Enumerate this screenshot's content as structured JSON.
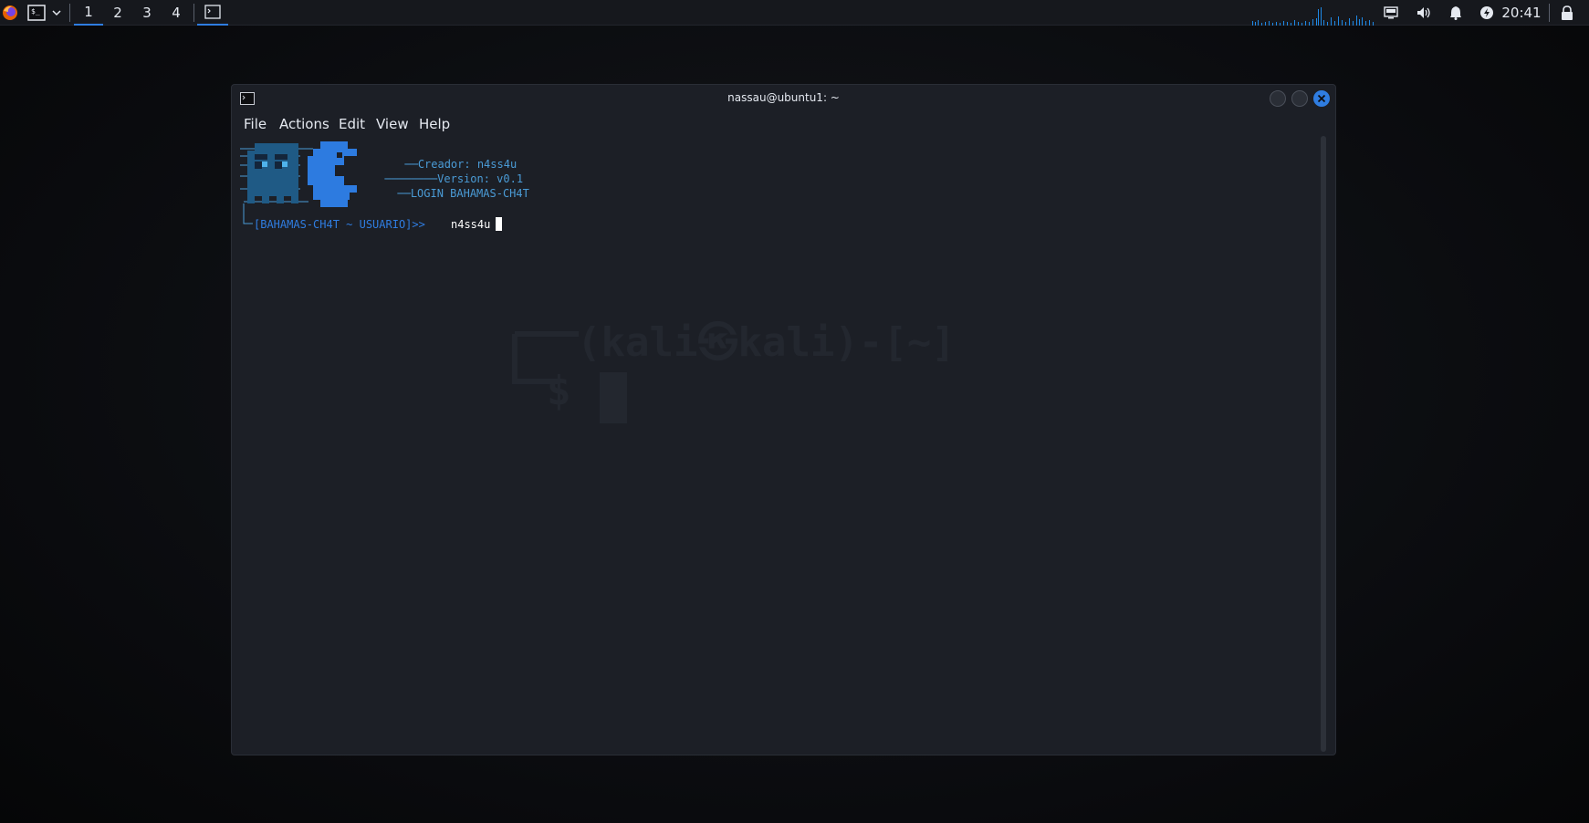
{
  "taskbar": {
    "workspaces": [
      "1",
      "2",
      "3",
      "4"
    ],
    "clock": "20:41"
  },
  "window": {
    "title": "nassau@ubuntu1: ~",
    "menu": [
      "File",
      "Actions",
      "Edit",
      "View",
      "Help"
    ]
  },
  "terminal": {
    "banner": {
      "creator": "Creador: n4ss4u",
      "version": "Version: v0.1",
      "login": "LOGIN BAHAMAS-CH4T"
    },
    "prompt": "[BAHAMAS-CH4T ~ USUARIO]>>",
    "input": "n4ss4u"
  },
  "wallpaper": {
    "prompt": "(kali㉿kali)-[~]",
    "dollar": "$"
  },
  "colors": {
    "accent": "#2f7de1",
    "terminal_text": "#4a9bd6",
    "ghost": "#1f5a85",
    "pacman": "#2d7be0"
  }
}
